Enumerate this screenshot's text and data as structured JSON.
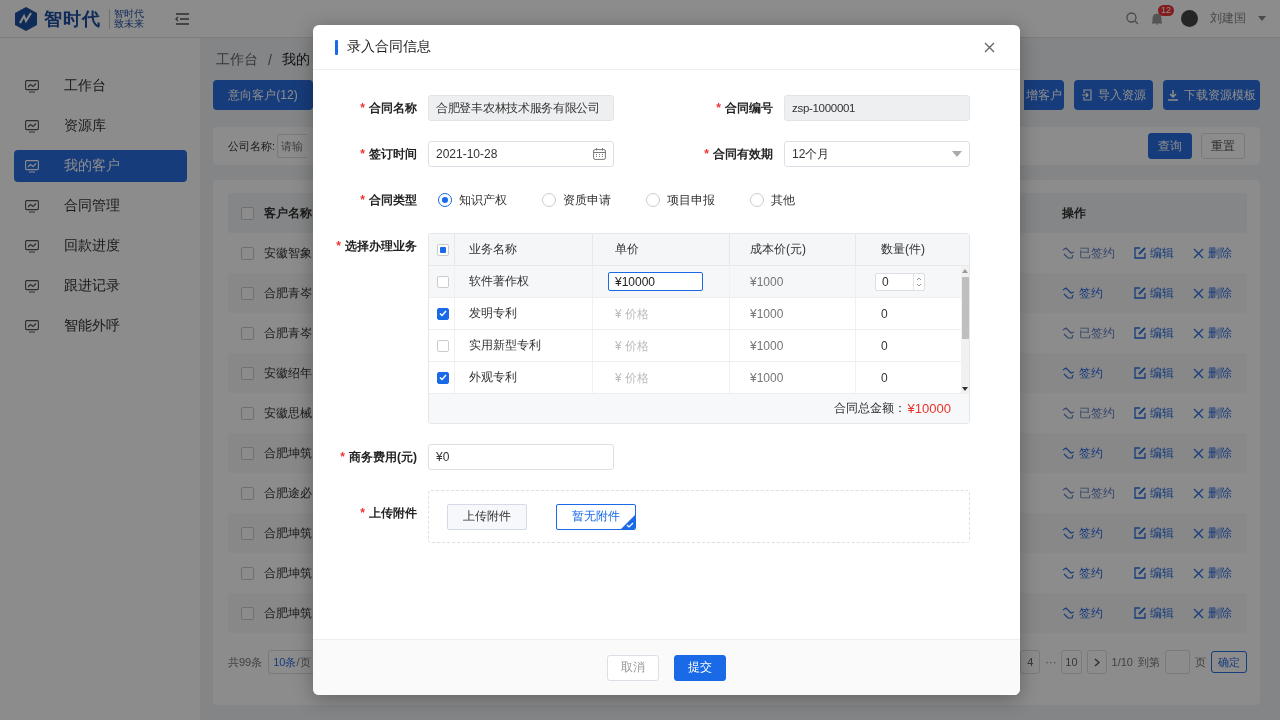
{
  "header": {
    "logo_text": "智时代",
    "tagline": [
      "智时代",
      "致未来"
    ],
    "notification_count": "12",
    "user_name": "刘建国"
  },
  "sidebar": {
    "items": [
      {
        "label": "工作台",
        "selected": false
      },
      {
        "label": "资源库",
        "selected": false
      },
      {
        "label": "我的客户",
        "selected": true
      },
      {
        "label": "合同管理",
        "selected": false
      },
      {
        "label": "回款进度",
        "selected": false
      },
      {
        "label": "跟进记录",
        "selected": false
      },
      {
        "label": "智能外呼",
        "selected": false
      }
    ]
  },
  "breadcrumb": {
    "items": [
      "工作台",
      "我的"
    ],
    "separator": "/"
  },
  "tabs": [
    {
      "label": "意向客户(12)",
      "selected": true
    }
  ],
  "toolbar_buttons": [
    {
      "label": "增客户",
      "kind": "cut"
    },
    {
      "label": "导入资源",
      "kind": "import"
    },
    {
      "label": "下载资源模板",
      "kind": "download"
    }
  ],
  "filter": {
    "label": "公司名称:",
    "placeholder": "请输",
    "buttons": [
      {
        "label": "查询",
        "kind": "primary"
      },
      {
        "label": "重置",
        "kind": "plain"
      }
    ]
  },
  "table": {
    "header_checked": false,
    "columns": [
      "客户名称",
      "操作"
    ],
    "rows": [
      {
        "checked": false,
        "name": "安徽智象",
        "signed": true,
        "sign_label": "已签约",
        "edit_label": "编辑",
        "delete_label": "删除"
      },
      {
        "checked": false,
        "name": "合肥青岑",
        "signed": false,
        "sign_label": "签约",
        "edit_label": "编辑",
        "delete_label": "删除"
      },
      {
        "checked": false,
        "name": "合肥青岑",
        "signed": true,
        "sign_label": "已签约",
        "edit_label": "编辑",
        "delete_label": "删除"
      },
      {
        "checked": false,
        "name": "安徽绍年",
        "signed": false,
        "sign_label": "签约",
        "edit_label": "编辑",
        "delete_label": "删除"
      },
      {
        "checked": false,
        "name": "安徽思械",
        "signed": true,
        "sign_label": "已签约",
        "edit_label": "编辑",
        "delete_label": "删除"
      },
      {
        "checked": false,
        "name": "合肥坤筑",
        "signed": false,
        "sign_label": "签约",
        "edit_label": "编辑",
        "delete_label": "删除"
      },
      {
        "checked": false,
        "name": "合肥途必",
        "signed": true,
        "sign_label": "已签约",
        "edit_label": "编辑",
        "delete_label": "删除"
      },
      {
        "checked": false,
        "name": "合肥坤筑",
        "signed": false,
        "sign_label": "签约",
        "edit_label": "编辑",
        "delete_label": "删除"
      },
      {
        "checked": false,
        "name": "合肥坤筑",
        "signed": false,
        "sign_label": "签约",
        "edit_label": "编辑",
        "delete_label": "删除"
      },
      {
        "checked": false,
        "name": "合肥坤筑",
        "signed": false,
        "sign_label": "签约",
        "edit_label": "编辑",
        "delete_label": "删除"
      }
    ]
  },
  "pagination": {
    "total": "共99条",
    "page_size_count": "10条",
    "page_size_unit": "/页",
    "pages": [
      "4",
      "10"
    ],
    "ellipsis": "···",
    "current": "1/10",
    "goto_label": "到第",
    "page_suffix": "页",
    "confirm": "确定"
  },
  "modal": {
    "title": "录入合同信息",
    "fields": [
      {
        "kind": "text",
        "mark": "*",
        "label": "合同名称",
        "value": "合肥登丰农林技术服务有限公司",
        "disabled": true
      },
      {
        "kind": "text",
        "mark": "*",
        "label": "合同编号",
        "value": "zsp-1000001",
        "disabled": true
      },
      {
        "kind": "date",
        "mark": "*",
        "label": "签订时间",
        "value": "2021-10-28"
      },
      {
        "kind": "select",
        "mark": "*",
        "label": "合同有效期",
        "value": "12个月"
      },
      {
        "kind": "radio",
        "mark": "*",
        "label": "合同类型",
        "options": [
          {
            "label": "知识产权",
            "selected": true
          },
          {
            "label": "资质申请",
            "selected": false
          },
          {
            "label": "项目申报",
            "selected": false
          },
          {
            "label": "其他",
            "selected": false
          }
        ]
      },
      {
        "kind": "table",
        "mark": "*",
        "label": "选择办理业务",
        "indeterminate": true,
        "columns": [
          "业务名称",
          "单价",
          "成本价(元)",
          "数量(件)"
        ],
        "rows": [
          {
            "checked": false,
            "name": "软件著作权",
            "editing": true,
            "price": "¥10000",
            "cost": "¥1000",
            "quantity": "0"
          },
          {
            "checked": true,
            "name": "发明专利",
            "editing": false,
            "price_placeholder": "¥ 价格",
            "cost": "¥1000",
            "quantity": "0"
          },
          {
            "checked": false,
            "name": "实用新型专利",
            "editing": false,
            "price_placeholder": "¥ 价格",
            "cost": "¥1000",
            "quantity": "0"
          },
          {
            "checked": true,
            "name": "外观专利",
            "editing": false,
            "price_placeholder": "¥ 价格",
            "cost": "¥1000",
            "quantity": "0"
          }
        ],
        "total_label": "合同总金额：",
        "total": "¥10000"
      },
      {
        "kind": "money",
        "mark": "*",
        "label": "商务费用(元)",
        "value": "¥0"
      },
      {
        "kind": "choice",
        "mark": "*",
        "label": "上传附件",
        "options": [
          {
            "label": "上传附件",
            "selected": false
          },
          {
            "label": "暂无附件",
            "selected": true
          }
        ]
      }
    ],
    "buttons": [
      {
        "label": "取消",
        "kind": "secondary"
      },
      {
        "label": "提交",
        "kind": "primary"
      }
    ]
  }
}
